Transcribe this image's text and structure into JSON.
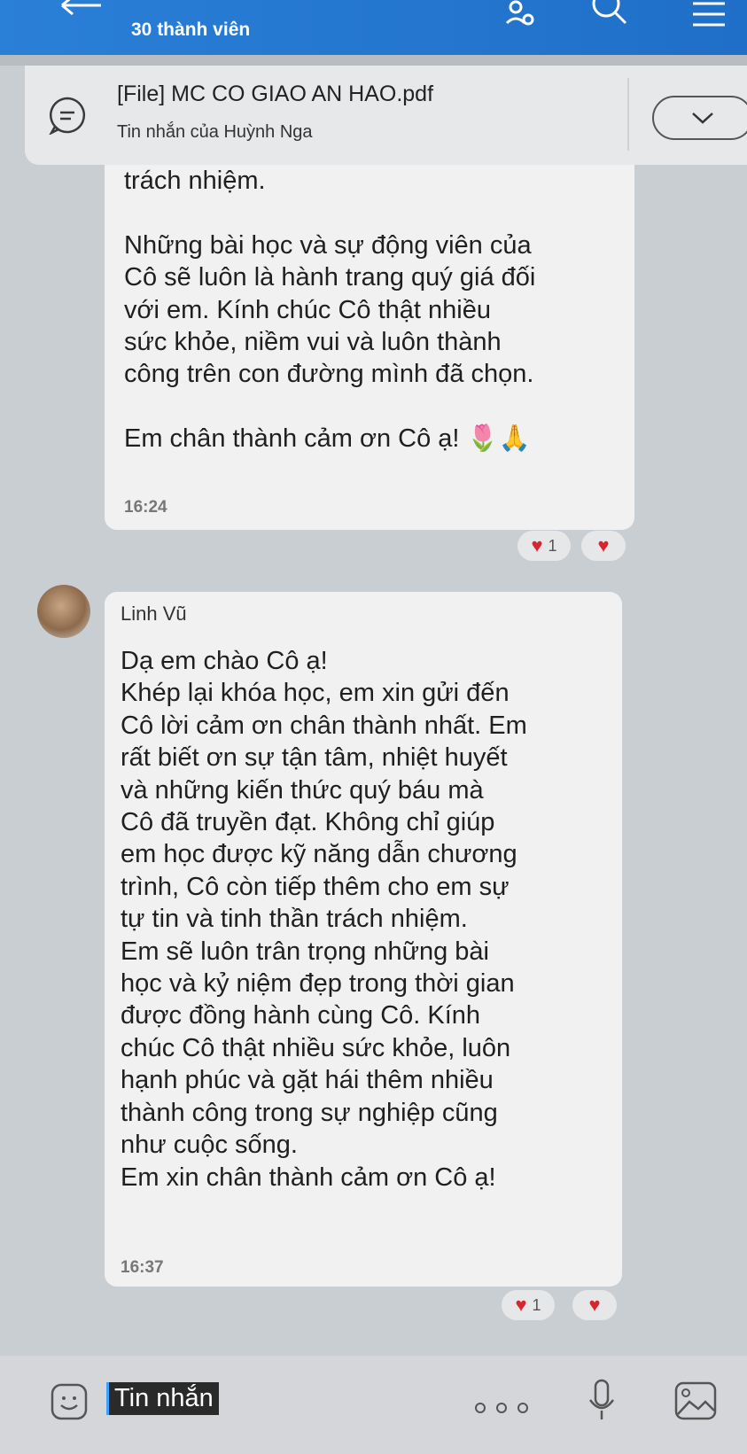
{
  "header": {
    "member_count": "30 thành viên",
    "icons": [
      "back-arrow-icon",
      "group-members-icon",
      "search-icon",
      "menu-icon"
    ],
    "color": "#2a7fd6"
  },
  "pinned": {
    "title": "[File] MC CO GIAO AN HAO.pdf",
    "subtitle": "Tin nhắn của Huỳnh Nga",
    "icon": "pinned-message-icon"
  },
  "messages": [
    {
      "lines": [
        "trách nhiệm.",
        "",
        "Những bài học và sự động viên của",
        "Cô sẽ luôn là hành trang quý giá đối",
        "với em. Kính chúc Cô thật nhiều",
        "sức khỏe, niềm vui và luôn thành",
        "công trên con đường mình đã chọn.",
        "",
        "Em chân thành cảm ơn Cô ạ! 🌷🙏"
      ],
      "time": "16:24",
      "reaction_count": "1"
    },
    {
      "sender": "Linh Vũ",
      "lines": [
        "Dạ em chào Cô ạ!",
        "Khép lại khóa học, em xin gửi đến",
        "Cô lời cảm ơn chân thành nhất. Em",
        "rất biết ơn sự tận tâm, nhiệt huyết",
        "và những kiến thức quý báu mà",
        "Cô đã truyền đạt. Không chỉ giúp",
        "em học được kỹ năng dẫn chương",
        "trình, Cô còn tiếp thêm cho em sự",
        "tự tin và tinh thần trách nhiệm.",
        "Em sẽ luôn trân trọng những bài",
        "học và kỷ niệm đẹp trong thời gian",
        "được đồng hành cùng Cô. Kính",
        "chúc Cô thật nhiều sức khỏe, luôn",
        "hạnh phúc và gặt hái thêm nhiều",
        "thành công trong sự nghiệp cũng",
        "như cuộc sống.",
        "Em xin chân thành cảm ơn Cô ạ!"
      ],
      "time": "16:37",
      "reaction_count": "1"
    }
  ],
  "input": {
    "value": "Tin nhắn",
    "icons": [
      "emoji-icon",
      "more-options-icon",
      "microphone-icon",
      "image-icon"
    ]
  }
}
